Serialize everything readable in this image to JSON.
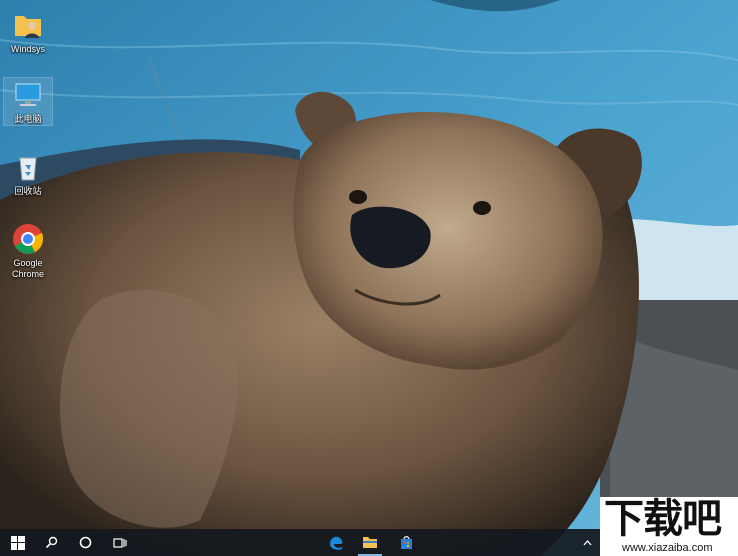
{
  "desktop": {
    "icons": [
      {
        "label": "Windsys",
        "icon": "user-folder-icon"
      },
      {
        "label": "此电脑",
        "icon": "this-pc-icon"
      },
      {
        "label": "回收站",
        "icon": "recycle-bin-icon"
      },
      {
        "label": "Google Chrome",
        "icon": "chrome-icon"
      }
    ]
  },
  "taskbar": {
    "items": [
      "start-icon",
      "search-icon",
      "cortana-icon",
      "task-view-icon",
      "edge-icon",
      "file-explorer-icon",
      "store-icon",
      "chevron-up-icon"
    ]
  },
  "watermark": {
    "title": "下载吧",
    "url": "www.xiazaiba.com"
  },
  "colors": {
    "taskbar": "#14181e",
    "edge": "#1e88d8",
    "folder": "#f2c14e",
    "store": "#2b7fd8"
  }
}
